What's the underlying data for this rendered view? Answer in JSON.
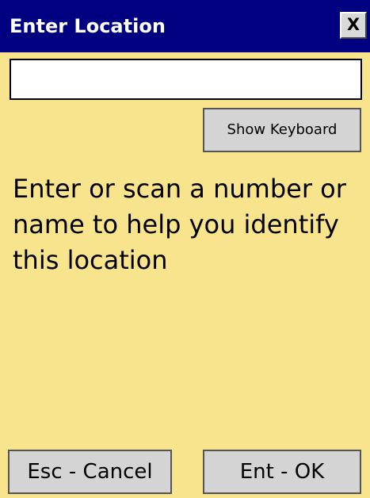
{
  "window": {
    "title": "Enter Location",
    "close_label": "X"
  },
  "location_field": {
    "value": "",
    "placeholder": ""
  },
  "show_keyboard_label": "Show Keyboard",
  "instruction": "Enter or scan a number or name to help you identify this location",
  "buttons": {
    "cancel_label": "Esc - Cancel",
    "ok_label": "Ent - OK"
  },
  "colors": {
    "title_bar": "#000080",
    "background": "#f7e48d",
    "button": "#d4d4d4"
  }
}
